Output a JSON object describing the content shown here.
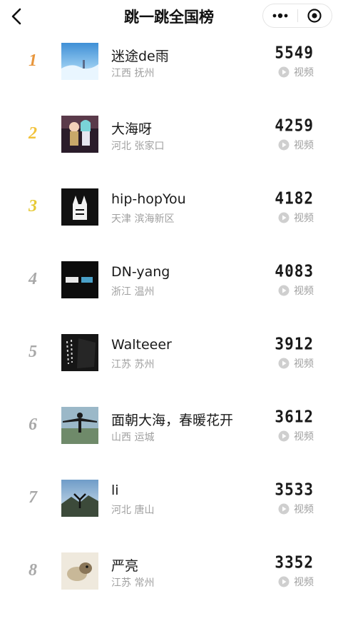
{
  "header": {
    "title": "跳一跳全国榜",
    "back_icon": "back-arrow-icon",
    "more_icon": "more-dots-icon",
    "close_icon": "target-close-icon"
  },
  "colors": {
    "rank1": "#e8963c",
    "rank2": "#f2c23a",
    "rank3": "#e6c935",
    "rank_other": "#a8a8a8"
  },
  "video_label": "视频",
  "rows": [
    {
      "rank": "1",
      "name": "迷途de雨",
      "location": "江西 抚州",
      "score": "5549",
      "video": "视频"
    },
    {
      "rank": "2",
      "name": "大海呀",
      "location": "河北 张家口",
      "score": "4259",
      "video": "视频"
    },
    {
      "rank": "3",
      "name": "hip-hopYou",
      "location": "天津 滨海新区",
      "score": "4182",
      "video": "视频"
    },
    {
      "rank": "4",
      "name": "DN-yang",
      "location": "浙江 温州",
      "score": "4083",
      "video": "视频"
    },
    {
      "rank": "5",
      "name": "Walteeer",
      "location": "江苏 苏州",
      "score": "3912",
      "video": "视频"
    },
    {
      "rank": "6",
      "name": "面朝大海，春暖花开",
      "location": "山西 运城",
      "score": "3612",
      "video": "视频"
    },
    {
      "rank": "7",
      "name": "li",
      "location": "河北 唐山",
      "score": "3533",
      "video": "视频"
    },
    {
      "rank": "8",
      "name": "严亮",
      "location": "江苏 常州",
      "score": "3352",
      "video": "视频"
    }
  ]
}
